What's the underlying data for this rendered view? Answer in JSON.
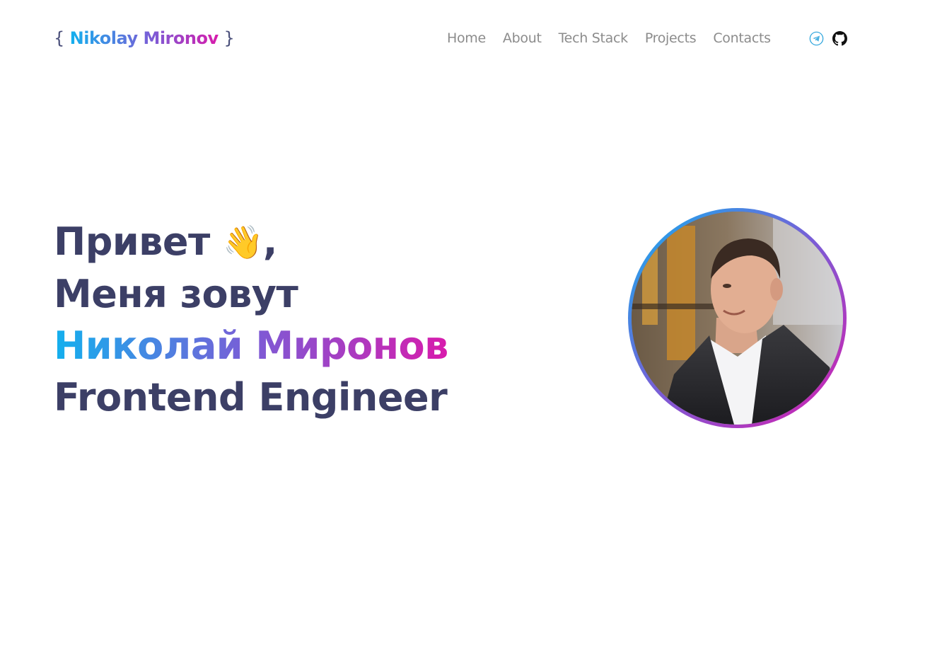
{
  "header": {
    "logo": {
      "open_brace": "{",
      "name": "Nikolay Mironov",
      "close_brace": "}"
    },
    "nav": [
      {
        "label": "Home"
      },
      {
        "label": "About"
      },
      {
        "label": "Tech Stack"
      },
      {
        "label": "Projects"
      },
      {
        "label": "Contacts"
      }
    ],
    "social": [
      {
        "icon": "telegram-icon"
      },
      {
        "icon": "github-icon"
      }
    ]
  },
  "hero": {
    "greeting": "Привет",
    "greeting_emoji": "👋",
    "greeting_comma": ",",
    "intro": "Меня зовут",
    "name": "Николай Миронов",
    "role": "Frontend Engineer"
  },
  "colors": {
    "gradient_start": "#13b0ee",
    "gradient_mid": "#7b5cd6",
    "gradient_end": "#d81bac",
    "heading": "#3c3f66",
    "nav_text": "#8c8c8c"
  }
}
